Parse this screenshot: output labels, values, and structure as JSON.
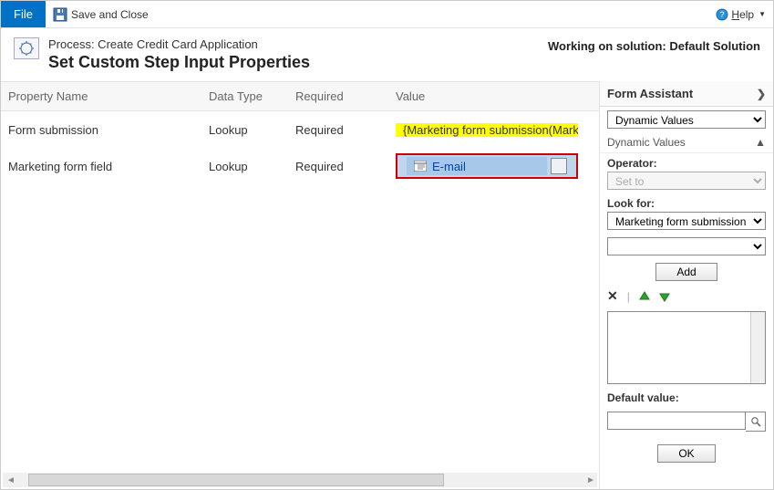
{
  "toolbar": {
    "file_label": "File",
    "save_label": "Save and Close",
    "help_label": "Help"
  },
  "header": {
    "process_label": "Process: Create Credit Card Application",
    "title": "Set Custom Step Input Properties",
    "working": "Working on solution: Default Solution"
  },
  "table": {
    "cols": {
      "c1": "Property Name",
      "c2": "Data Type",
      "c3": "Required",
      "c4": "Value"
    },
    "rows": [
      {
        "name": "Form submission",
        "type": "Lookup",
        "req": "Required",
        "value": "{Marketing form submission(Mark"
      },
      {
        "name": "Marketing form field",
        "type": "Lookup",
        "req": "Required",
        "value": "E-mail"
      }
    ]
  },
  "assistant": {
    "title": "Form Assistant",
    "section_select": "Dynamic Values",
    "section_title": "Dynamic Values",
    "operator_label": "Operator:",
    "operator_value": "Set to",
    "lookfor_label": "Look for:",
    "lookfor_value": "Marketing form submission",
    "lookfor_value2": "",
    "add_button": "Add",
    "default_label": "Default value:",
    "default_value": "",
    "ok_button": "OK"
  }
}
